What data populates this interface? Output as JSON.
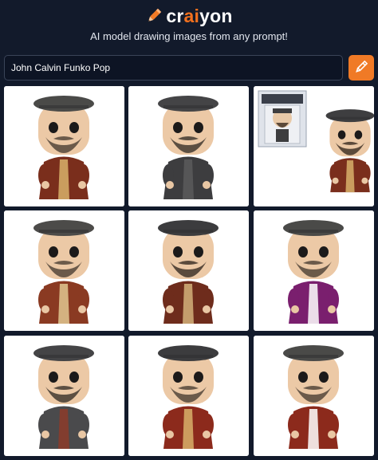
{
  "brand": {
    "name_part1": "cr",
    "name_part2": "ai",
    "name_part3": "yon",
    "tagline": "AI model drawing images from any prompt!",
    "accent": "#f07a26"
  },
  "search": {
    "value": "John Calvin Funko Pop",
    "button_icon": "pencil-icon"
  },
  "results": [
    {
      "robe": "#7a2e1c",
      "trim": "#d8b06a",
      "beard": "#6b5a4a",
      "hat": "#4a4a48",
      "box": false
    },
    {
      "robe": "#3d3d3f",
      "trim": "#5a5a5c",
      "beard": "#5c4f42",
      "hat": "#444446",
      "box": false
    },
    {
      "robe": "#7a2e1c",
      "trim": "#d8b06a",
      "beard": "#5c4a3a",
      "hat": "#3e3e40",
      "box": true
    },
    {
      "robe": "#8a3a22",
      "trim": "#e0c890",
      "beard": "#6b5a4a",
      "hat": "#4c4b49",
      "box": false
    },
    {
      "robe": "#6e2c1c",
      "trim": "#d4b27a",
      "beard": "#5a4a3c",
      "hat": "#3c3c3e",
      "box": false
    },
    {
      "robe": "#7a1f6e",
      "trim": "#ffffff",
      "beard": "#6b5a4a",
      "hat": "#4a4a48",
      "box": false
    },
    {
      "robe": "#4a4a4c",
      "trim": "#8c3b2a",
      "beard": "#5c4f42",
      "hat": "#444446",
      "box": false
    },
    {
      "robe": "#8c2a1c",
      "trim": "#d8b06a",
      "beard": "#6b5a4a",
      "hat": "#3c3c3e",
      "box": false
    },
    {
      "robe": "#8c2a1c",
      "trim": "#ffffff",
      "beard": "#6b5a4a",
      "hat": "#4a4a48",
      "box": false
    }
  ]
}
